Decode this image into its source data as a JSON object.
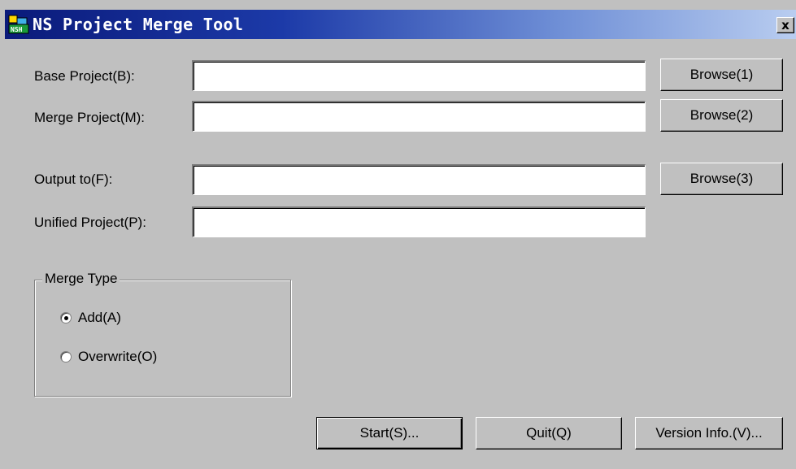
{
  "window": {
    "title": "NS Project Merge Tool",
    "close_label": "x",
    "app_icon": "ns-app-icon"
  },
  "fields": {
    "base_project": {
      "label": "Base Project(B):",
      "value": "",
      "browse_label": "Browse(1)"
    },
    "merge_project": {
      "label": "Merge Project(M):",
      "value": "",
      "browse_label": "Browse(2)"
    },
    "output_to": {
      "label": "Output to(F):",
      "value": "",
      "browse_label": "Browse(3)"
    },
    "unified_project": {
      "label": "Unified Project(P):",
      "value": ""
    }
  },
  "merge_type": {
    "title": "Merge Type",
    "options": [
      {
        "label": "Add(A)",
        "selected": true
      },
      {
        "label": "Overwrite(O)",
        "selected": false
      }
    ]
  },
  "actions": {
    "start_label": "Start(S)...",
    "quit_label": "Quit(Q)",
    "version_label": "Version Info.(V)..."
  },
  "colors": {
    "face": "#c0c0c0",
    "title_start": "#0a1a7a",
    "title_end": "#b9cdf0"
  }
}
